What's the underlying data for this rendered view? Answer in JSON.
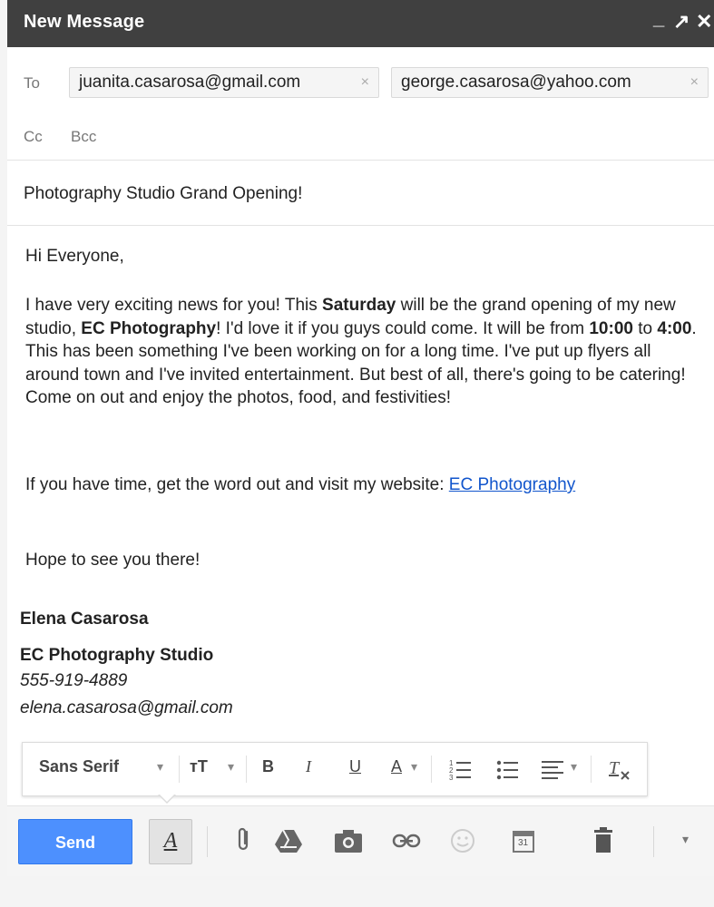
{
  "window": {
    "title": "New Message",
    "minimize": "_",
    "popout": "↗",
    "close": "✕"
  },
  "recipients": {
    "to_label": "To",
    "to": [
      "juanita.casarosa@gmail.com",
      "george.casarosa@yahoo.com"
    ],
    "remove_glyph": "×",
    "cc_label": "Cc",
    "bcc_label": "Bcc"
  },
  "subject": "Photography Studio Grand Opening!",
  "body": {
    "greeting": "Hi Everyone,",
    "p1_a": "I have very exciting news for you! This ",
    "p1_b": "Saturday",
    "p1_c": " will be the grand opening of my new studio, ",
    "p1_d": "EC Photography",
    "p1_e": "! I'd love it if you guys could come. It will be from ",
    "p1_f": "10:00",
    "p1_g": " to ",
    "p1_h": "4:00",
    "p1_i": ". This has been something I've been working on for a long time. I've put up flyers all around town and I've invited entertainment. But best of all, there's going to be catering! Come on out and enjoy the photos, food, and festivities!",
    "p2_text": "If you have time, get the word out and visit my website: ",
    "p2_link": "EC Photography",
    "closing": "Hope to see you there!"
  },
  "signature": {
    "name": "Elena Casarosa",
    "company": "EC Photography Studio",
    "phone": "555-919-4889",
    "email": "elena.casarosa@gmail.com"
  },
  "format_toolbar": {
    "font": "Sans Serif",
    "font_dropdown": "▾",
    "size": "тT",
    "bold": "B",
    "italic": "I",
    "underline": "U",
    "text_color": "A",
    "align_dropdown": "▾"
  },
  "bottom_toolbar": {
    "send": "Send",
    "format_toggle": "A",
    "calendar_day": "31",
    "more": "▾"
  },
  "colors": {
    "send": "#4d90fe",
    "titlebar": "#404040",
    "link": "#1155cc"
  }
}
